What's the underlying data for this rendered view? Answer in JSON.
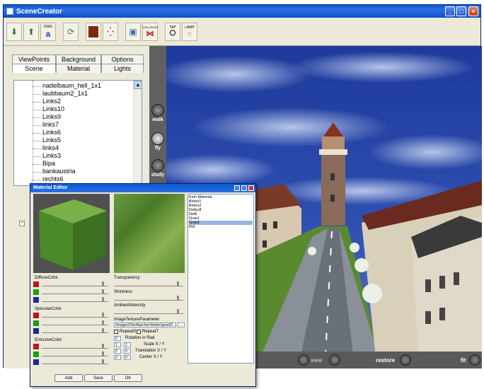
{
  "app": {
    "title": "SceneCreator"
  },
  "tabs": {
    "row1": [
      "ViewPoints",
      "Background",
      "Options"
    ],
    "row2": [
      "Scene",
      "Material",
      "Lights"
    ]
  },
  "tree": {
    "items": [
      "nadelbaum_hell_1x1",
      "laubbaum2_1x1",
      "Links2",
      "Links10",
      "Links9",
      "links7",
      "Links6",
      "Links5",
      "links4",
      "Links3",
      "Bipa",
      "bankaustria",
      "rechts6"
    ]
  },
  "toolbar": {
    "icons": [
      "import-icon",
      "export-icon",
      "dwg-icon",
      "refresh-icon",
      "texture-icon",
      "points-icon",
      "render-icon",
      "collision-icon",
      "tap-icon",
      "lamp-icon"
    ],
    "labels": {
      "dwg": "DWG",
      "collision": "COLLISION",
      "tap": "TAP",
      "lamp": "LAMP"
    }
  },
  "viewport": {
    "nav": [
      "walk",
      "fly",
      "study"
    ],
    "bottom": {
      "view": "view",
      "restore": "restore",
      "fit": "fit"
    }
  },
  "material_editor": {
    "title": "Material Editor",
    "diffuse_label": "DiffuseColor",
    "specular_label": "SpecularColor",
    "emissive_label": "EmissiveColor",
    "transparency_label": "Transparency",
    "shininess_label": "Shininess",
    "ambient_label": "AmbientIntensity",
    "texture_param_label": "ImageTextureParameter",
    "texture_path": "\\Images\\Oberflaechen\\boden\\gras02...",
    "repeat_s": "RepeatS",
    "repeat_t": "RepeatT",
    "rotation": "Rotation in Rad",
    "scale": "Scale X / Y",
    "translation": "Translation X / Y",
    "center": "Center X / Y",
    "rotation_value": "0",
    "scale_x": "1",
    "scale_y": "1",
    "translation_x": "0",
    "translation_y": "0",
    "center_x": "0",
    "center_y": "0",
    "materials": [
      "Kein Material",
      "Beton1",
      "Beton2",
      "Default",
      "Gelb",
      "Gras1",
      "Gras2",
      "Rot"
    ],
    "selected_material": "Gras2",
    "buttons": {
      "add": "Add",
      "save": "Save",
      "ok": "OK"
    },
    "browse_button": "...",
    "colors": {
      "red": "#c0161a",
      "green": "#18a018",
      "blue": "#1a2a9a"
    }
  }
}
